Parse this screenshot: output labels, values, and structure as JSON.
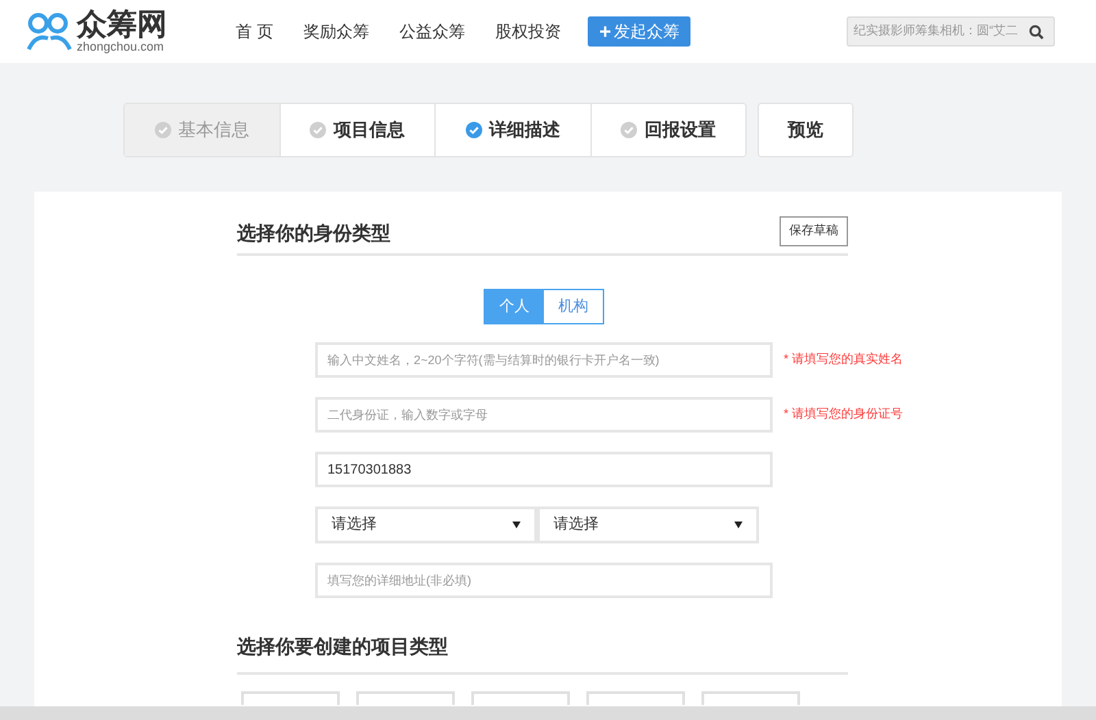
{
  "header": {
    "logo": {
      "name": "众筹网",
      "domain": "zhongchou.com"
    },
    "nav": [
      {
        "label": "首 页"
      },
      {
        "label": "奖励众筹"
      },
      {
        "label": "公益众筹"
      },
      {
        "label": "股权投资"
      }
    ],
    "launch_button": {
      "icon": "+",
      "label": "发起众筹"
    },
    "search": {
      "placeholder": "纪实摄影师筹集相机：圆“艾二"
    }
  },
  "steps": [
    {
      "label": "基本信息",
      "selected": false,
      "disabled": true
    },
    {
      "label": "项目信息",
      "selected": false,
      "disabled": false
    },
    {
      "label": "详细描述",
      "selected": true,
      "disabled": false
    },
    {
      "label": "回报设置",
      "selected": false,
      "disabled": false
    }
  ],
  "preview_button": "预览",
  "identity_section": {
    "title": "选择你的身份类型",
    "save_draft": "保存草稿",
    "identity_types": [
      {
        "label": "个人",
        "selected": true
      },
      {
        "label": "机构",
        "selected": false
      }
    ],
    "fields": [
      {
        "kind": "input",
        "placeholder": "输入中文姓名，2~20个字符(需与结算时的银行卡开户名一致)",
        "hint": "* 请填写您的真实姓名"
      },
      {
        "kind": "input",
        "placeholder": "二代身份证，输入数字或字母",
        "hint": "* 请填写您的身份证号"
      },
      {
        "kind": "input",
        "value": "15170301883"
      },
      {
        "kind": "selects",
        "options": [
          "请选择",
          "请选择"
        ]
      },
      {
        "kind": "input",
        "placeholder": "填写您的详细地址(非必填)"
      }
    ]
  },
  "project_type_section": {
    "title": "选择你要创建的项目类型"
  }
}
